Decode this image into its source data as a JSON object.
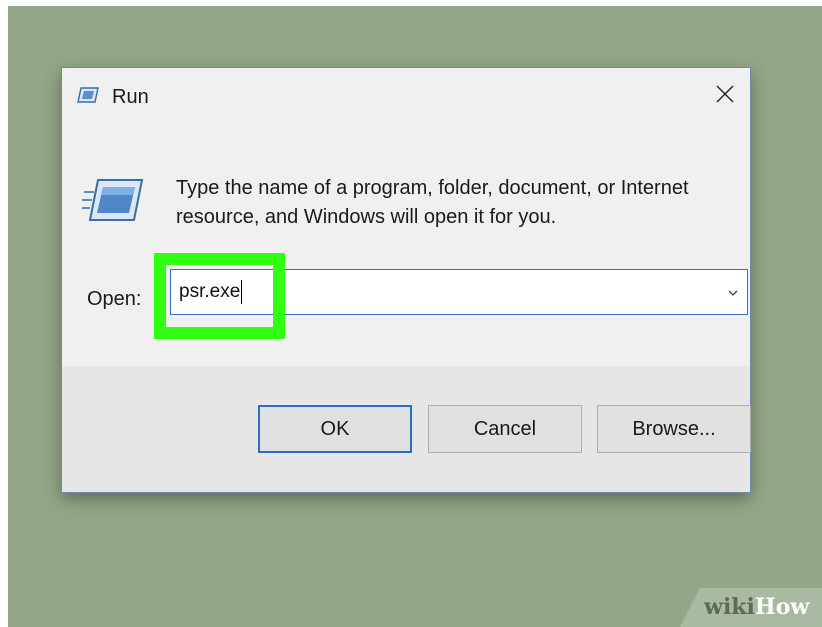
{
  "dialog": {
    "title": "Run",
    "description": "Type the name of a program, folder, document, or Internet resource, and Windows will open it for you.",
    "open_label": "Open:",
    "open_value": "psr.exe",
    "buttons": {
      "ok": "OK",
      "cancel": "Cancel",
      "browse": "Browse..."
    },
    "icons": {
      "title": "run-icon",
      "large": "run-icon",
      "close": "close-icon",
      "dropdown": "chevron-down-icon"
    }
  },
  "watermark": {
    "wiki": "wiki",
    "how": "How"
  },
  "colors": {
    "background": "#93a788",
    "dialog": "#f0f0f0",
    "highlight": "#32ff14",
    "focus_border": "#2d6bc7"
  }
}
